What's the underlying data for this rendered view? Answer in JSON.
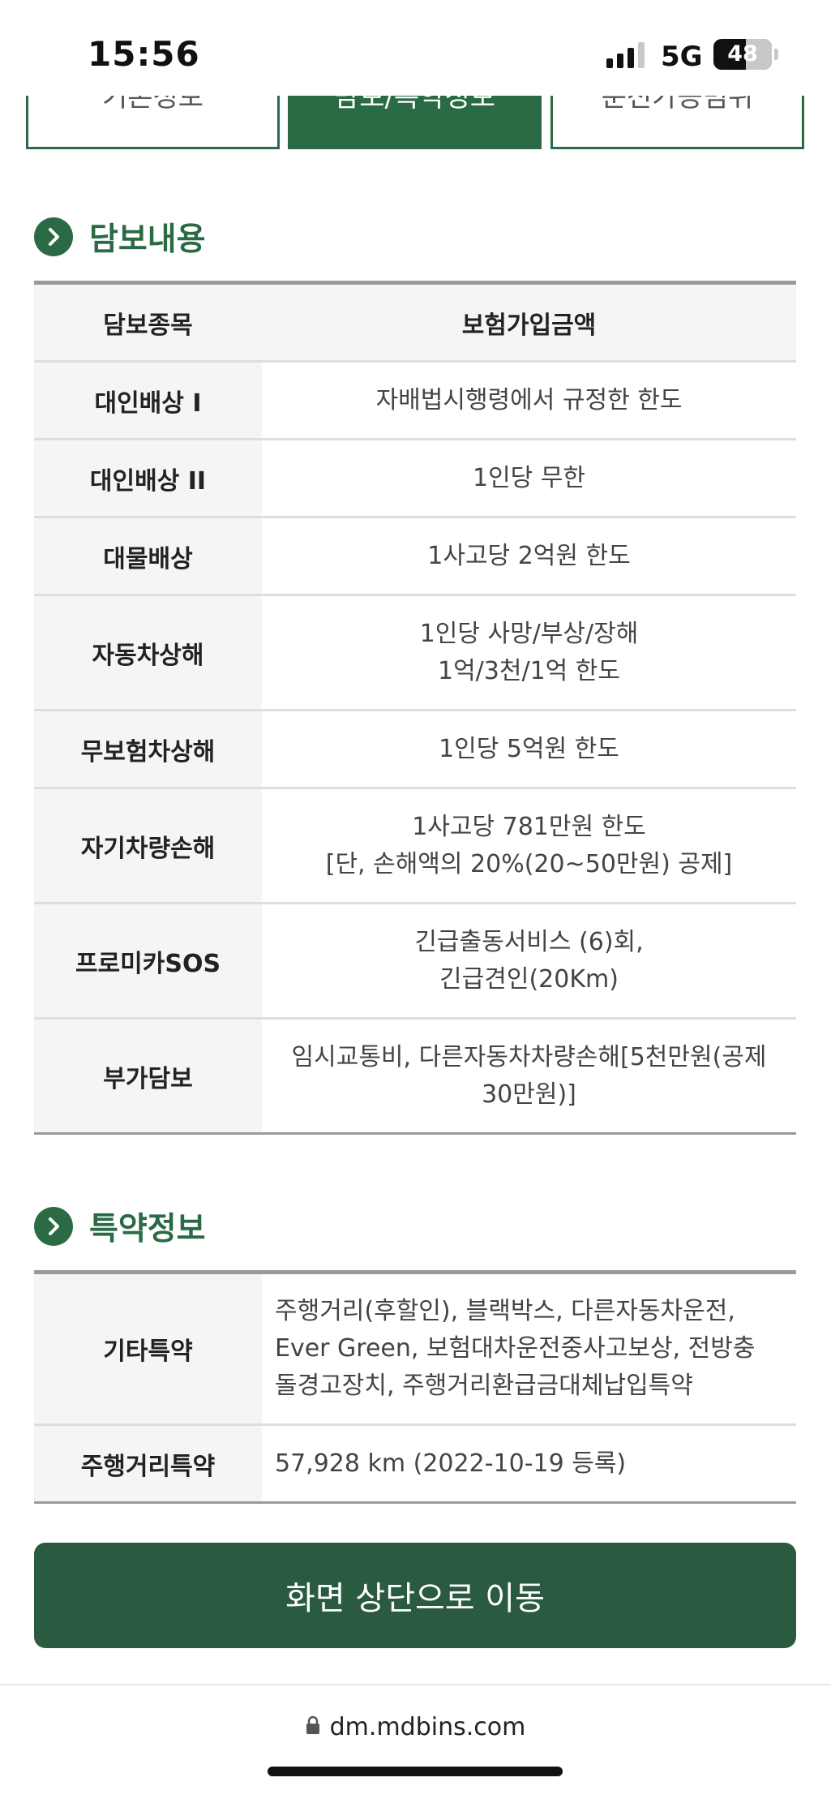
{
  "status_bar": {
    "time": "15:56",
    "network": "5G",
    "battery": "48"
  },
  "tabs": [
    {
      "label": "기본정보",
      "active": false
    },
    {
      "label": "담보/특약정보",
      "active": true
    },
    {
      "label": "운전가능범위",
      "active": false
    }
  ],
  "coverage": {
    "title": "담보내용",
    "headers": [
      "담보종목",
      "보험가입금액"
    ],
    "rows": [
      {
        "item": "대인배상 I",
        "amount": [
          "자배법시행령에서 규정한 한도"
        ]
      },
      {
        "item": "대인배상 II",
        "amount": [
          "1인당 무한"
        ]
      },
      {
        "item": "대물배상",
        "amount": [
          "1사고당 2억원 한도"
        ]
      },
      {
        "item": "자동차상해",
        "amount": [
          "1인당 사망/부상/장해",
          "1억/3천/1억 한도"
        ]
      },
      {
        "item": "무보험차상해",
        "amount": [
          "1인당 5억원 한도"
        ]
      },
      {
        "item": "자기차량손해",
        "amount": [
          "1사고당 781만원 한도",
          "[단, 손해액의 20%(20~50만원) 공제]"
        ]
      },
      {
        "item": "프로미카SOS",
        "amount": [
          "긴급출동서비스 (6)회,",
          "긴급견인(20Km)"
        ]
      },
      {
        "item": "부가담보",
        "amount": [
          "임시교통비, 다른자동차차량손해[5천만원(공제",
          "30만원)]"
        ]
      }
    ]
  },
  "special": {
    "title": "특약정보",
    "rows": [
      {
        "item": "기타특약",
        "value": [
          "주행거리(후할인), 블랙박스, 다른자동차운전,",
          "Ever Green, 보험대차운전중사고보상, 전방충",
          "돌경고장치, 주행거리환급금대체납입특약"
        ]
      },
      {
        "item": "주행거리특약",
        "value": [
          "57,928 km (2022-10-19 등록)"
        ]
      }
    ]
  },
  "scroll_top_button": "화면 상단으로 이동",
  "browser": {
    "url": "dm.mdbins.com"
  },
  "colors": {
    "brand_green": "#2a6a45",
    "button_green": "#2a5a40"
  }
}
